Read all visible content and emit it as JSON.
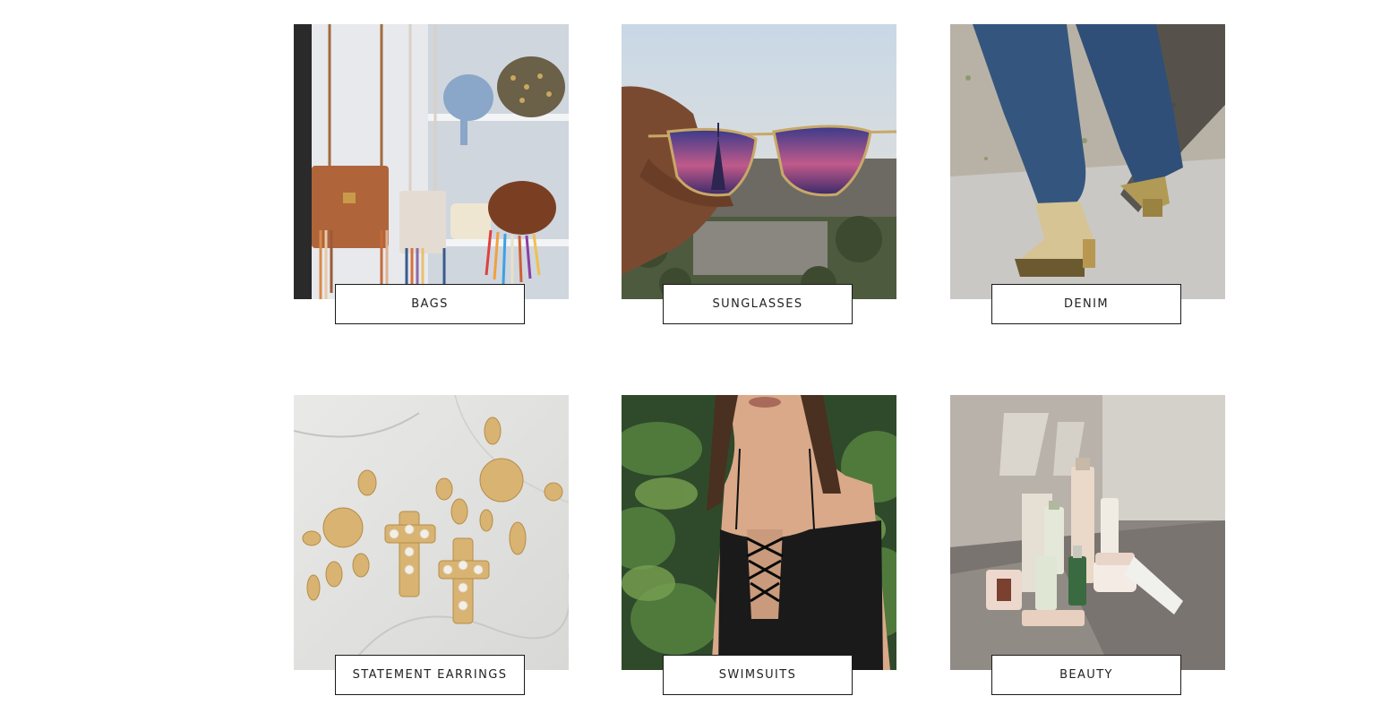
{
  "categories": [
    {
      "label": "BAGS",
      "image": "bags-closet-photo"
    },
    {
      "label": "SUNGLASSES",
      "image": "sunglasses-paris-photo"
    },
    {
      "label": "DENIM",
      "image": "denim-shoes-photo"
    },
    {
      "label": "STATEMENT EARRINGS",
      "image": "gold-earrings-photo"
    },
    {
      "label": "SWIMSUITS",
      "image": "black-swimsuit-photo"
    },
    {
      "label": "BEAUTY",
      "image": "skincare-products-photo"
    }
  ]
}
